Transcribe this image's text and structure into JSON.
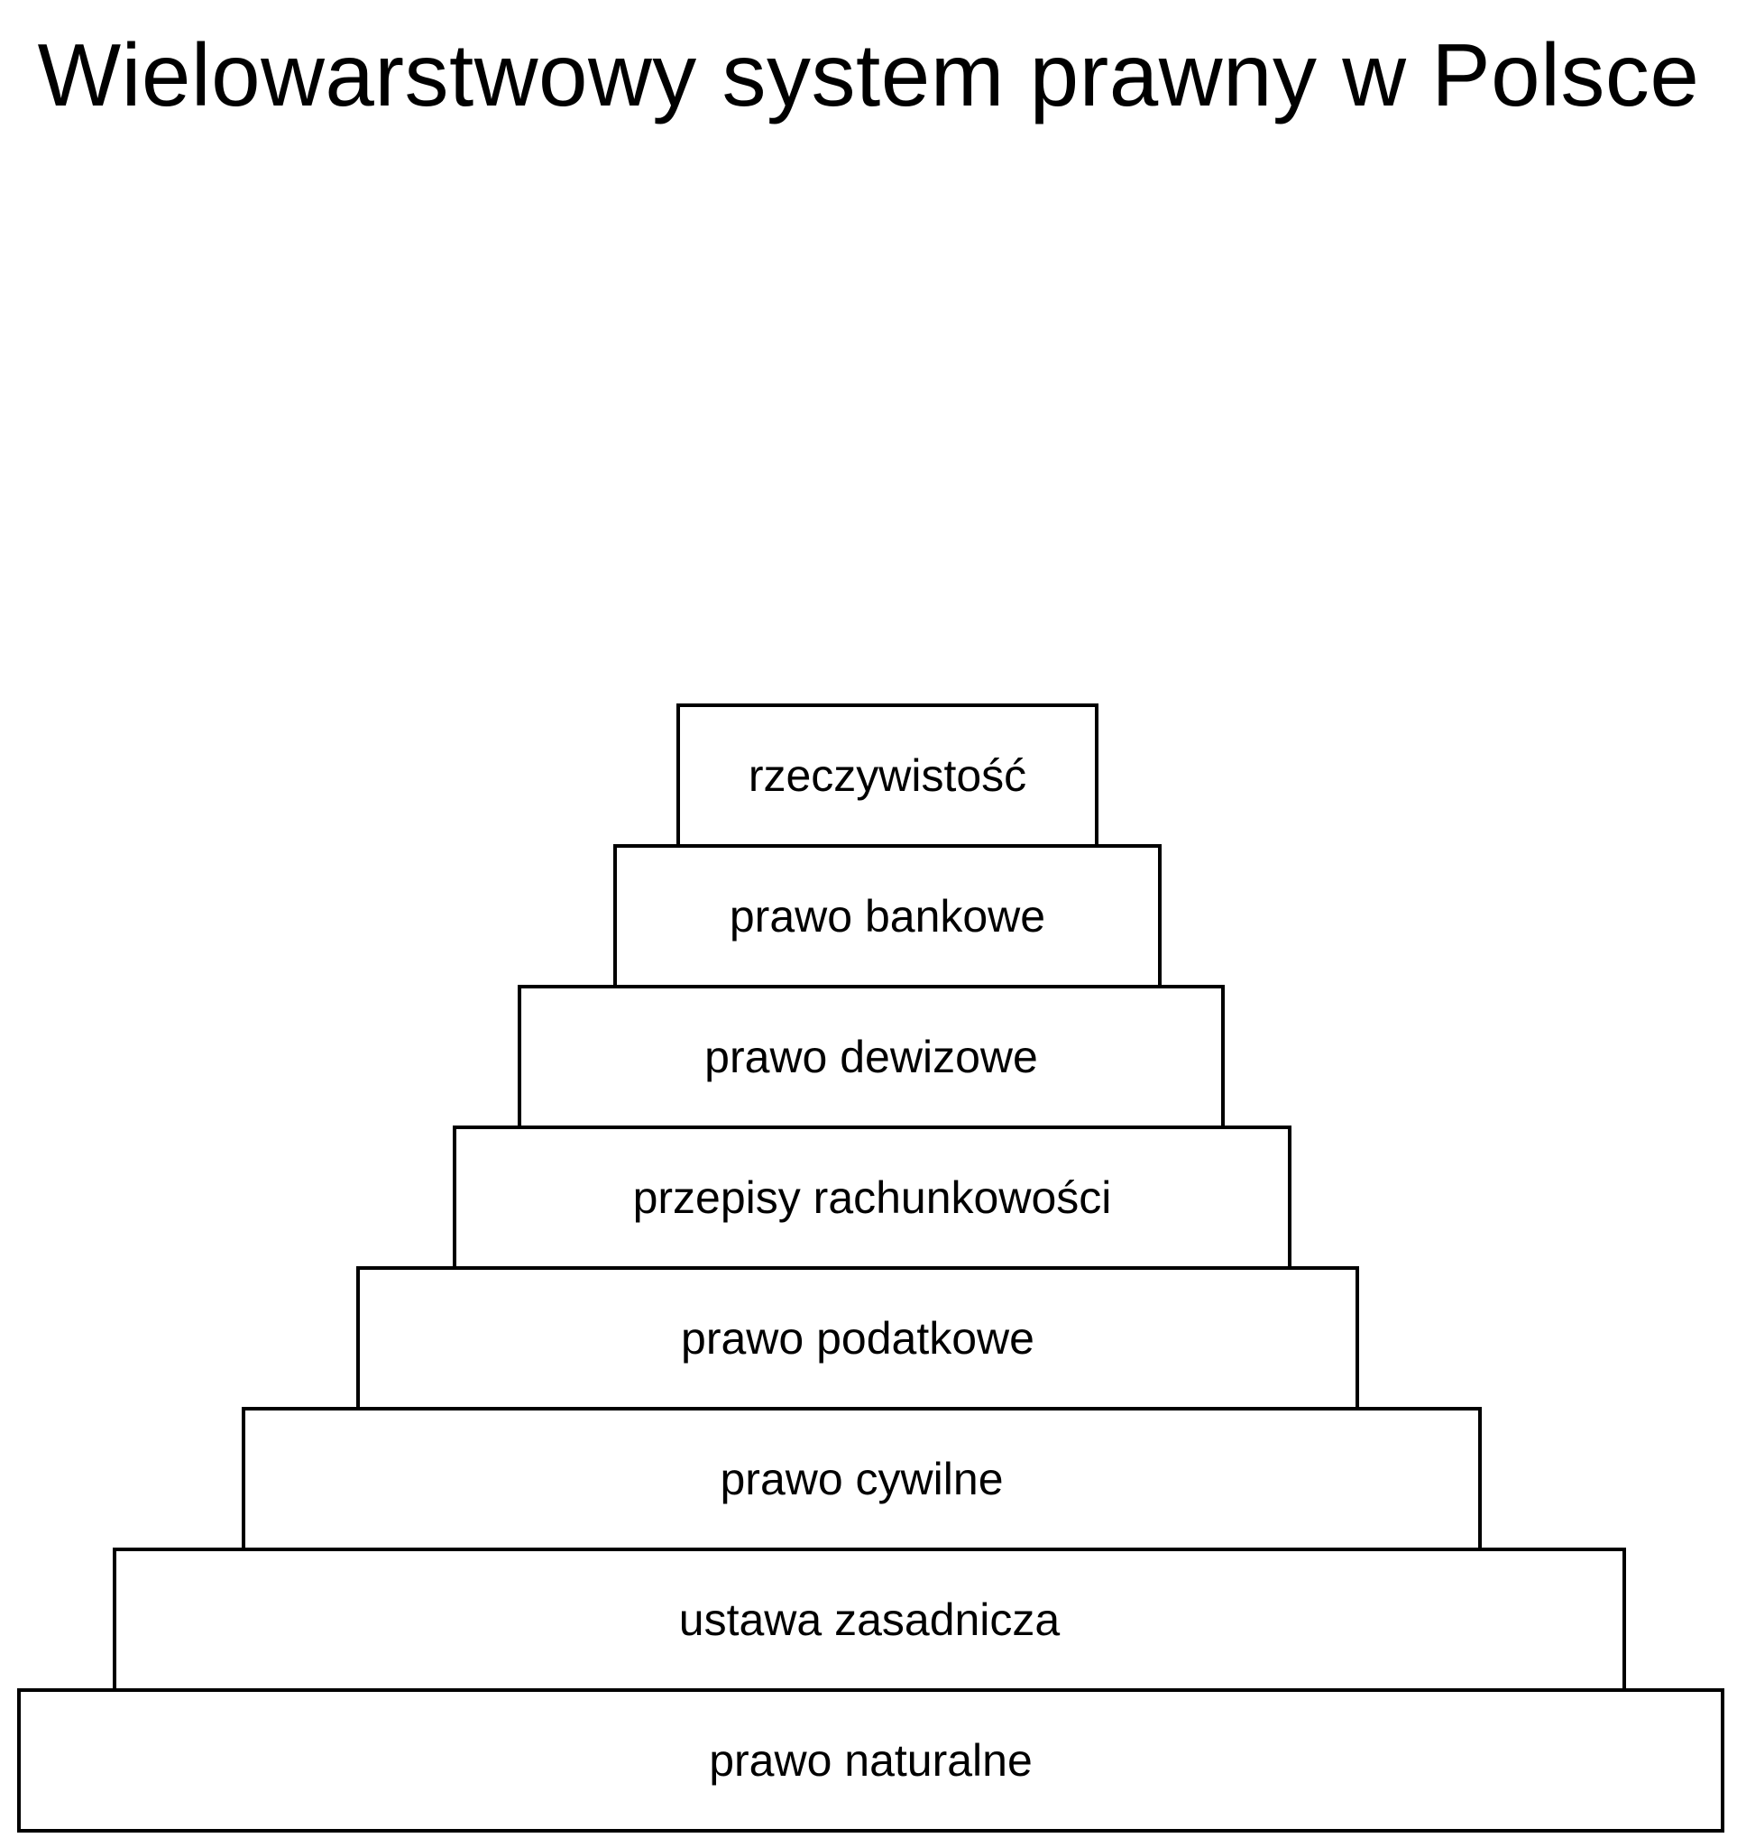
{
  "title": "Wielowarstwowy system prawny w Polsce",
  "tiers": [
    {
      "label": "rzeczywistość"
    },
    {
      "label": "prawo bankowe"
    },
    {
      "label": "prawo dewizowe"
    },
    {
      "label": "przepisy rachunkowości"
    },
    {
      "label": "prawo podatkowe"
    },
    {
      "label": "prawo cywilne"
    },
    {
      "label": "ustawa zasadnicza"
    },
    {
      "label": "prawo naturalne"
    }
  ]
}
